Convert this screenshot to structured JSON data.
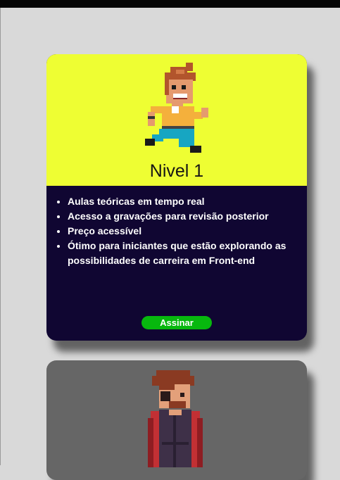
{
  "plans": [
    {
      "level": "Nivel 1",
      "benefits": [
        "Aulas teóricas em tempo real",
        "Acesso a gravações para revisão posterior",
        "Preço acessível",
        "Ótimo para iniciantes que estão explorando as possibilidades de carreira em Front-end"
      ],
      "cta_label": "Assinar",
      "colors": {
        "hero": "#eefe33",
        "body": "#100632",
        "cta": "#07b80e"
      },
      "character_icon": "pixel-runner-character-icon"
    },
    {
      "colors": {
        "hero": "#666666"
      },
      "character_icon": "pixel-caped-character-icon"
    }
  ]
}
